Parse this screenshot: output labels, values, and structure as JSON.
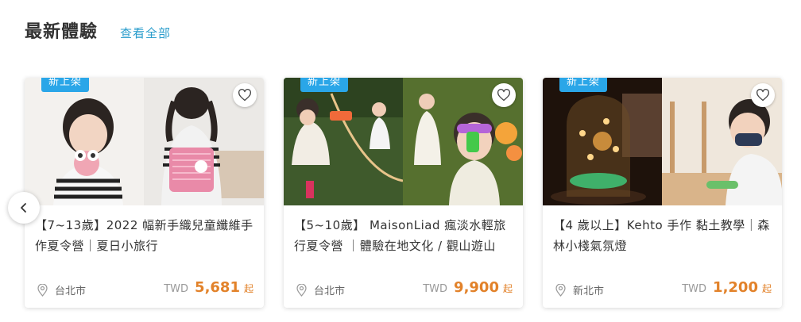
{
  "section": {
    "title": "最新體驗",
    "view_all": "查看全部"
  },
  "colors": {
    "accent_blue": "#2aa6e8",
    "link_blue": "#2a9dcc",
    "price_orange": "#e2822a"
  },
  "icons": {
    "prev": "chevron-left-icon",
    "favorite": "heart-outline-icon",
    "location": "location-pin-icon"
  },
  "cards": [
    {
      "badge": "新上架",
      "title": "【7~13歲】2022 幅新手織兒童纖維手作夏令營｜夏日小旅行",
      "location": "台北市",
      "currency": "TWD",
      "price": "5,681",
      "price_suffix": "起"
    },
    {
      "badge": "新上架",
      "title": "【5~10歲】 MaisonLiad 瘋淡水輕旅行夏令營 ｜體驗在地文化 / 觀山遊山",
      "location": "台北市",
      "currency": "TWD",
      "price": "9,900",
      "price_suffix": "起"
    },
    {
      "badge": "新上架",
      "title": "【4 歲以上】Kehto 手作 黏土教學｜森林小棧氣氛燈",
      "location": "新北市",
      "currency": "TWD",
      "price": "1,200",
      "price_suffix": "起"
    }
  ]
}
